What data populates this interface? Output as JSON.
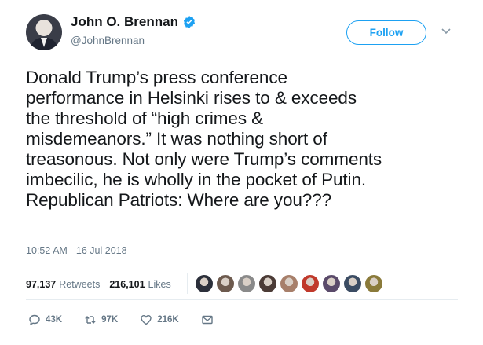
{
  "author": {
    "display_name": "John O. Brennan",
    "handle": "@JohnBrennan",
    "verified": true
  },
  "follow_button_label": "Follow",
  "tweet": {
    "text": "Donald Trump’s press conference\nperformance in Helsinki rises to & exceeds\nthe threshold of “high crimes &\nmisdemeanors.” It was nothing short of\ntreasonous. Not only were Trump’s comments\nimbecilic, he is wholly in the pocket of Putin.\nRepublican Patriots: Where are you???",
    "timestamp": "10:52 AM - 16 Jul 2018"
  },
  "stats": {
    "retweets_count": "97,137",
    "retweets_label": "Retweets",
    "likes_count": "216,101",
    "likes_label": "Likes"
  },
  "likers_colors": [
    "#2b2f3a",
    "#6d5a4e",
    "#8a8a8a",
    "#4b3b36",
    "#a77f6a",
    "#c0392b",
    "#5a4a6a",
    "#3b4c63",
    "#8a7a3a"
  ],
  "actions": {
    "reply_count": "43K",
    "retweet_count": "97K",
    "like_count": "216K"
  },
  "colors": {
    "accent": "#1da1f2",
    "secondary_text": "#657786"
  }
}
